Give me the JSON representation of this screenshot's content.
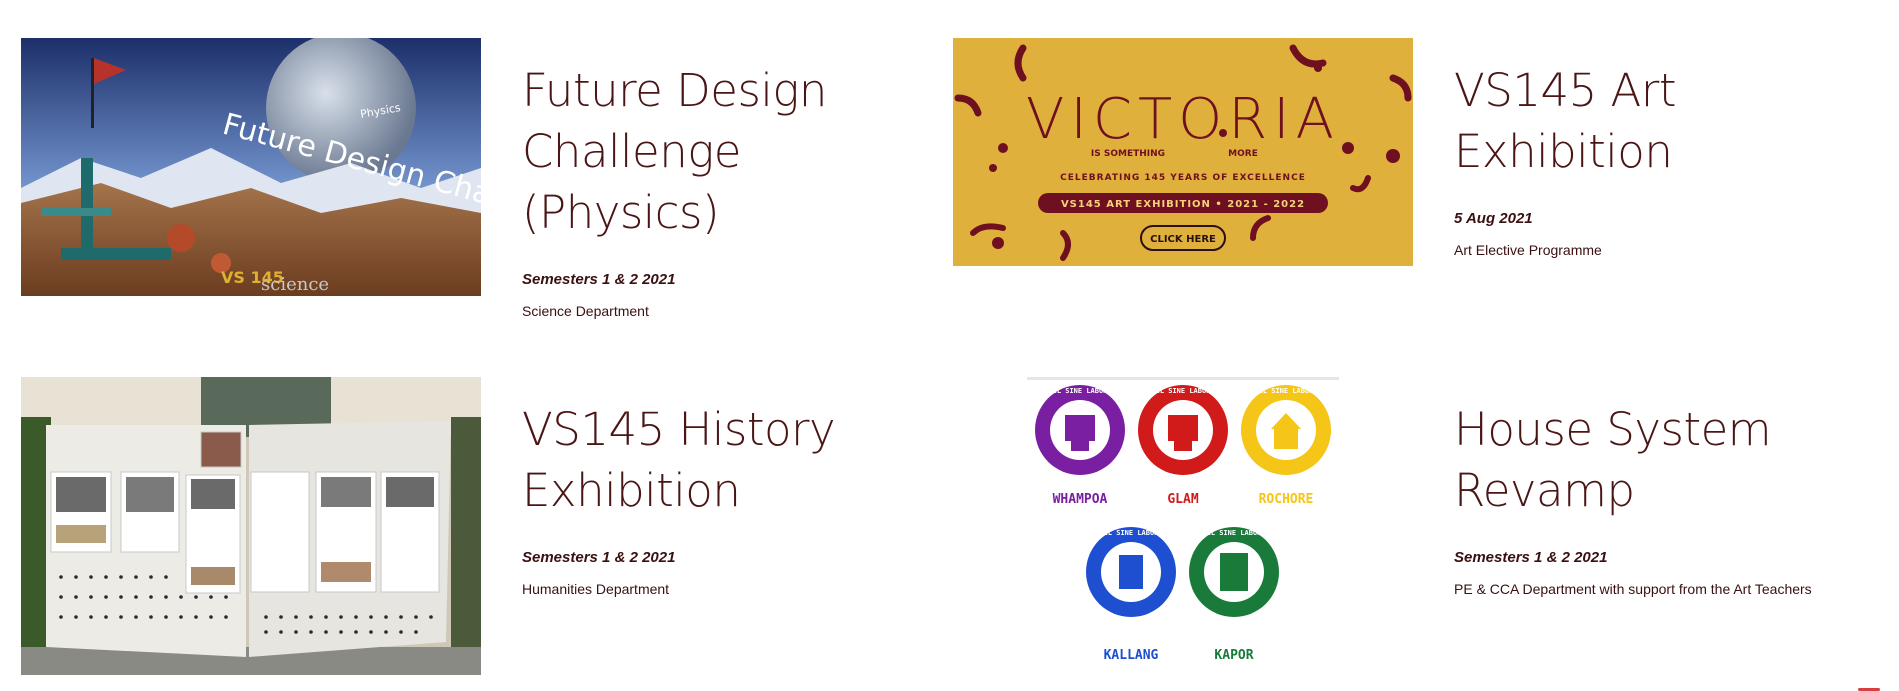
{
  "projects": [
    {
      "title": "Future Design Challenge (Physics)",
      "date": "Semesters 1 & 2 2021",
      "department": "Science Department",
      "image_text": {
        "main": "Future Design Challenge",
        "sub": "Physics",
        "brand": "VS 145",
        "science": "science"
      }
    },
    {
      "title": "VS145 Art Exhibition",
      "date": "5 Aug 2021",
      "department": "Art Elective Programme",
      "image_text": {
        "main": "VICTORIA",
        "tagline_left": "IS SOMETHING",
        "tagline_right": "MORE",
        "celebrating": "CELEBRATING 145 YEARS OF EXCELLENCE",
        "banner": "VS145 ART EXHIBITION  •  2021 - 2022",
        "cta": "CLICK HERE"
      }
    },
    {
      "title": "VS145 History Exhibition",
      "date": "Semesters 1 & 2 2021",
      "department": "Humanities Department",
      "image_text": {}
    },
    {
      "title": "House System Revamp",
      "date": "Semesters 1 & 2 2021",
      "department": "PE & CCA Department with support from the Art Teachers",
      "image_text": {
        "motto": "NIL SINE LABORE",
        "houses": [
          "WHAMPOA",
          "GLAM",
          "ROCHORE",
          "KALLANG",
          "KAPOR"
        ]
      }
    }
  ],
  "colors": {
    "title": "#4a1515",
    "whampoa": "#7a1fa2",
    "glam": "#d11a1a",
    "rochore": "#f5c518",
    "kallang": "#1f4fd1",
    "kapor": "#1a7a3a",
    "art_bg": "#e0b03c",
    "art_maroon": "#6e1020"
  }
}
